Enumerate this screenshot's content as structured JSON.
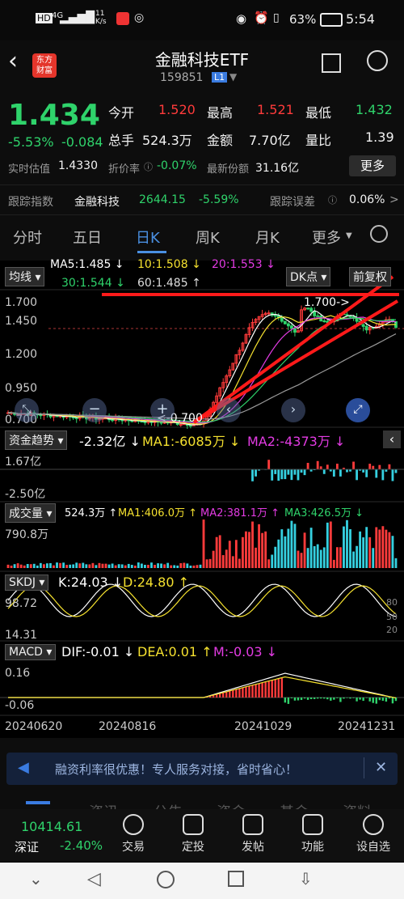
{
  "status_bar": {
    "hd": "HD",
    "network": "4G",
    "speed": "11\nK/s",
    "battery": "63%",
    "time": "5:54"
  },
  "header": {
    "logo_line1": "东方",
    "logo_line2": "财富",
    "title": "金融科技ETF",
    "code": "159851",
    "level_badge": "L1"
  },
  "quote": {
    "price": "1.434",
    "change_pct": "-5.53%",
    "change": "-0.084",
    "labels": {
      "open": "今开",
      "high": "最高",
      "low": "最低",
      "volume": "总手",
      "amount": "金额",
      "vol_ratio": "量比",
      "iopv": "实时估值",
      "premium": "折价率",
      "shares": "最新份额"
    },
    "values": {
      "open": "1.520",
      "high": "1.521",
      "low": "1.432",
      "volume": "524.3万",
      "amount": "7.70亿",
      "vol_ratio": "1.39",
      "iopv": "1.4330",
      "premium": "-0.07%",
      "shares": "31.16亿"
    },
    "more_button": "更多"
  },
  "tracking": {
    "index_label": "跟踪指数",
    "index_name": "金融科技",
    "index_value": "2644.15",
    "index_change": "-5.59%",
    "error_label": "跟踪误差",
    "error_value": "0.06%",
    "arrow": ">"
  },
  "tabs": [
    "分时",
    "五日",
    "日K",
    "周K",
    "月K",
    "更多"
  ],
  "active_tab": "日K",
  "ma_panel": {
    "label": "均线",
    "ma5": "MA5:1.485",
    "ma10": "10:1.508",
    "ma20": "20:1.553",
    "ma30": "30:1.544",
    "ma60": "60:1.485",
    "dk_button": "DK点",
    "adjust_button": "前复权",
    "price_ticks": [
      "1.700",
      "1.450",
      "1.200",
      "0.950",
      "0.700"
    ],
    "high_marker": "1.700",
    "low_marker": "0.700"
  },
  "fund_flow": {
    "label": "资金趋势",
    "value": "-2.32亿",
    "ma1": "MA1:-6085万",
    "ma2": "MA2:-4373万",
    "top": "1.67亿",
    "bottom": "-2.50亿"
  },
  "volume": {
    "label": "成交量",
    "value": "524.3万",
    "ma1": "MA1:406.0万",
    "ma2": "MA2:381.1万",
    "ma3": "MA3:426.5万",
    "top": "790.8万"
  },
  "skdj": {
    "label": "SKDJ",
    "k": "K:24.03",
    "d": "D:24.80",
    "top": "98.72",
    "bottom": "14.31",
    "r80": "80",
    "r50": "50",
    "r20": "20"
  },
  "macd": {
    "label": "MACD",
    "dif": "DIF:-0.01",
    "dea": "DEA:0.01",
    "m": "M:-0.03",
    "top": "0.16",
    "bottom": "-0.06"
  },
  "dates": [
    "20240620",
    "20240816",
    "20241029",
    "20241231"
  ],
  "banner": {
    "text": "融资利率很优惠！专人服务对接，省时省心！",
    "close": "✕"
  },
  "bottom_tabs_hidden": [
    "资讯",
    "公告",
    "资金",
    "基金",
    "资料"
  ],
  "bottom_nav": {
    "index_value": "10414.61",
    "index_name": "深证",
    "index_change": "-2.40%",
    "buttons": [
      "交易",
      "定投",
      "发帖",
      "功能",
      "设自选"
    ]
  },
  "colors": {
    "up": "#ff3b3b",
    "down": "#2fd36b",
    "accent": "#4a90e2",
    "ma5": "#ffffff",
    "ma10": "#f5e12f",
    "ma20": "#e33be3",
    "ma30": "#2fd36b",
    "ma60": "#9a9a9a"
  }
}
